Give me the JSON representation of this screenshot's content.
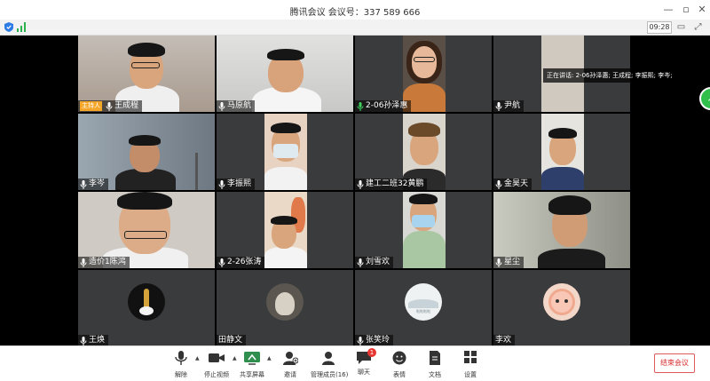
{
  "window": {
    "title": "腾讯会议 会议号：337 589 666"
  },
  "infobar": {
    "timer": "09:28"
  },
  "speaking_banner": "正在讲话: 2-06孙泽惠; 王成程; 李振熙; 李岑;",
  "host_tag": "主持人",
  "participants": [
    {
      "name": "王成程"
    },
    {
      "name": "马原航"
    },
    {
      "name": "2-06孙泽惠"
    },
    {
      "name": "尹航"
    },
    {
      "name": "李岑"
    },
    {
      "name": "李振熙"
    },
    {
      "name": "建工二班32黄鹏"
    },
    {
      "name": "金昊天"
    },
    {
      "name": "造价1陈鸿"
    },
    {
      "name": "2-26张涛"
    },
    {
      "name": "刘雪欢"
    },
    {
      "name": "星尘"
    },
    {
      "name": "王焕"
    },
    {
      "name": "田静文"
    },
    {
      "name": "张笑玲"
    },
    {
      "name": "李欢"
    }
  ],
  "avatar_text": {
    "landscape": "啦啦啦啦"
  },
  "toolbar": {
    "mute": "解除",
    "video": "停止视频",
    "share": "共享屏幕",
    "invite": "邀请",
    "members": "管理成员(16)",
    "chat": "聊天",
    "chat_badge": "1",
    "reactions": "表情",
    "docs": "文档",
    "settings": "设置",
    "end": "结束会议"
  },
  "colors": {
    "accent": "#2fbf4a",
    "host": "#f4a62a",
    "end": "#d92c2c"
  }
}
